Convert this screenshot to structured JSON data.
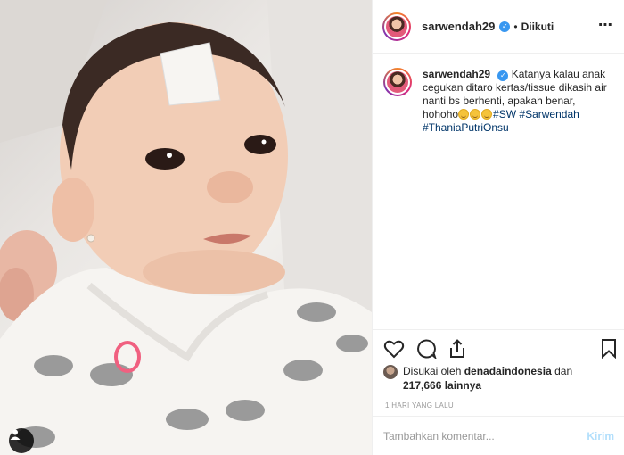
{
  "post": {
    "username": "sarwendah29",
    "verified_icon": "verified-badge-icon",
    "follow_status": "Diikuti",
    "separator": "•",
    "caption_text": "Katanya kalau anak cegukan ditaro kertas/tissue dikasih air nanti bs berhenti, apakah benar, hohoho",
    "hashtags": [
      "#SW",
      "#Sarwendah",
      "#ThaniaPutriOnsu"
    ],
    "likes_prefix": "Disukai oleh",
    "likes_user": "denadaindonesia",
    "likes_middle": "dan",
    "likes_count": "217,666 lainnya",
    "time": "1 HARI YANG LALU",
    "comment_placeholder": "Tambahkan komentar...",
    "send_label": "Kirim"
  },
  "colors": {
    "accent": "#3897f0",
    "hashtag": "#003569",
    "send_disabled": "#b2dffc",
    "border": "#efefef"
  }
}
